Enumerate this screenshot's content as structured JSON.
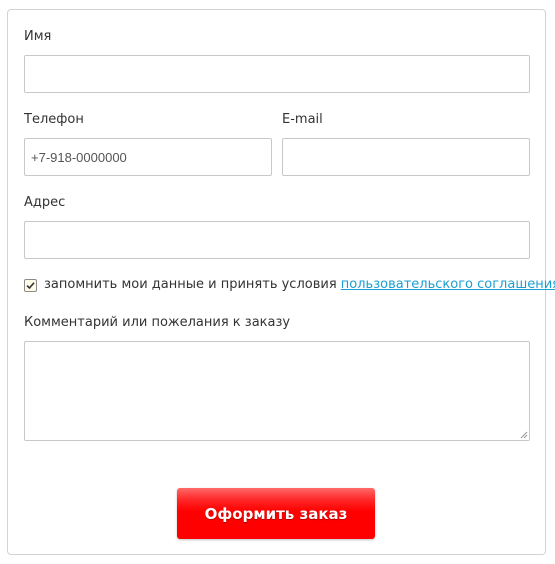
{
  "form": {
    "name_label": "Имя",
    "name_value": "",
    "phone_label": "Телефон",
    "phone_placeholder": "+7-918-0000000",
    "email_label": "E-mail",
    "email_value": "",
    "address_label": "Адрес",
    "address_value": "",
    "agree_checked": true,
    "agree_text": "запомнить мои данные и принять условия",
    "agree_link": "пользовательского соглашения",
    "comment_label": "Комментарий или пожелания к заказу",
    "comment_value": "",
    "submit_label": "Оформить заказ"
  },
  "colors": {
    "submit_bg": "#ff0000",
    "link": "#1a9fd3",
    "border": "#c8c8c8"
  }
}
